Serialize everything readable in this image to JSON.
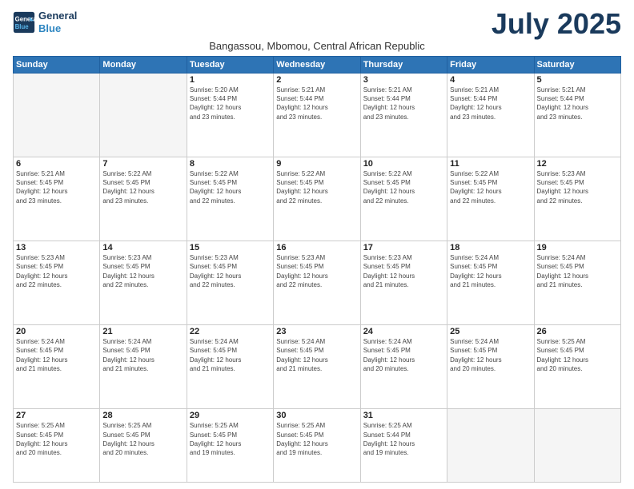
{
  "logo": {
    "line1": "General",
    "line2": "Blue"
  },
  "title": "July 2025",
  "location": "Bangassou, Mbomou, Central African Republic",
  "days_header": [
    "Sunday",
    "Monday",
    "Tuesday",
    "Wednesday",
    "Thursday",
    "Friday",
    "Saturday"
  ],
  "weeks": [
    [
      {
        "day": "",
        "info": ""
      },
      {
        "day": "",
        "info": ""
      },
      {
        "day": "1",
        "info": "Sunrise: 5:20 AM\nSunset: 5:44 PM\nDaylight: 12 hours\nand 23 minutes."
      },
      {
        "day": "2",
        "info": "Sunrise: 5:21 AM\nSunset: 5:44 PM\nDaylight: 12 hours\nand 23 minutes."
      },
      {
        "day": "3",
        "info": "Sunrise: 5:21 AM\nSunset: 5:44 PM\nDaylight: 12 hours\nand 23 minutes."
      },
      {
        "day": "4",
        "info": "Sunrise: 5:21 AM\nSunset: 5:44 PM\nDaylight: 12 hours\nand 23 minutes."
      },
      {
        "day": "5",
        "info": "Sunrise: 5:21 AM\nSunset: 5:44 PM\nDaylight: 12 hours\nand 23 minutes."
      }
    ],
    [
      {
        "day": "6",
        "info": "Sunrise: 5:21 AM\nSunset: 5:45 PM\nDaylight: 12 hours\nand 23 minutes."
      },
      {
        "day": "7",
        "info": "Sunrise: 5:22 AM\nSunset: 5:45 PM\nDaylight: 12 hours\nand 23 minutes."
      },
      {
        "day": "8",
        "info": "Sunrise: 5:22 AM\nSunset: 5:45 PM\nDaylight: 12 hours\nand 22 minutes."
      },
      {
        "day": "9",
        "info": "Sunrise: 5:22 AM\nSunset: 5:45 PM\nDaylight: 12 hours\nand 22 minutes."
      },
      {
        "day": "10",
        "info": "Sunrise: 5:22 AM\nSunset: 5:45 PM\nDaylight: 12 hours\nand 22 minutes."
      },
      {
        "day": "11",
        "info": "Sunrise: 5:22 AM\nSunset: 5:45 PM\nDaylight: 12 hours\nand 22 minutes."
      },
      {
        "day": "12",
        "info": "Sunrise: 5:23 AM\nSunset: 5:45 PM\nDaylight: 12 hours\nand 22 minutes."
      }
    ],
    [
      {
        "day": "13",
        "info": "Sunrise: 5:23 AM\nSunset: 5:45 PM\nDaylight: 12 hours\nand 22 minutes."
      },
      {
        "day": "14",
        "info": "Sunrise: 5:23 AM\nSunset: 5:45 PM\nDaylight: 12 hours\nand 22 minutes."
      },
      {
        "day": "15",
        "info": "Sunrise: 5:23 AM\nSunset: 5:45 PM\nDaylight: 12 hours\nand 22 minutes."
      },
      {
        "day": "16",
        "info": "Sunrise: 5:23 AM\nSunset: 5:45 PM\nDaylight: 12 hours\nand 22 minutes."
      },
      {
        "day": "17",
        "info": "Sunrise: 5:23 AM\nSunset: 5:45 PM\nDaylight: 12 hours\nand 21 minutes."
      },
      {
        "day": "18",
        "info": "Sunrise: 5:24 AM\nSunset: 5:45 PM\nDaylight: 12 hours\nand 21 minutes."
      },
      {
        "day": "19",
        "info": "Sunrise: 5:24 AM\nSunset: 5:45 PM\nDaylight: 12 hours\nand 21 minutes."
      }
    ],
    [
      {
        "day": "20",
        "info": "Sunrise: 5:24 AM\nSunset: 5:45 PM\nDaylight: 12 hours\nand 21 minutes."
      },
      {
        "day": "21",
        "info": "Sunrise: 5:24 AM\nSunset: 5:45 PM\nDaylight: 12 hours\nand 21 minutes."
      },
      {
        "day": "22",
        "info": "Sunrise: 5:24 AM\nSunset: 5:45 PM\nDaylight: 12 hours\nand 21 minutes."
      },
      {
        "day": "23",
        "info": "Sunrise: 5:24 AM\nSunset: 5:45 PM\nDaylight: 12 hours\nand 21 minutes."
      },
      {
        "day": "24",
        "info": "Sunrise: 5:24 AM\nSunset: 5:45 PM\nDaylight: 12 hours\nand 20 minutes."
      },
      {
        "day": "25",
        "info": "Sunrise: 5:24 AM\nSunset: 5:45 PM\nDaylight: 12 hours\nand 20 minutes."
      },
      {
        "day": "26",
        "info": "Sunrise: 5:25 AM\nSunset: 5:45 PM\nDaylight: 12 hours\nand 20 minutes."
      }
    ],
    [
      {
        "day": "27",
        "info": "Sunrise: 5:25 AM\nSunset: 5:45 PM\nDaylight: 12 hours\nand 20 minutes."
      },
      {
        "day": "28",
        "info": "Sunrise: 5:25 AM\nSunset: 5:45 PM\nDaylight: 12 hours\nand 20 minutes."
      },
      {
        "day": "29",
        "info": "Sunrise: 5:25 AM\nSunset: 5:45 PM\nDaylight: 12 hours\nand 19 minutes."
      },
      {
        "day": "30",
        "info": "Sunrise: 5:25 AM\nSunset: 5:45 PM\nDaylight: 12 hours\nand 19 minutes."
      },
      {
        "day": "31",
        "info": "Sunrise: 5:25 AM\nSunset: 5:44 PM\nDaylight: 12 hours\nand 19 minutes."
      },
      {
        "day": "",
        "info": ""
      },
      {
        "day": "",
        "info": ""
      }
    ]
  ]
}
